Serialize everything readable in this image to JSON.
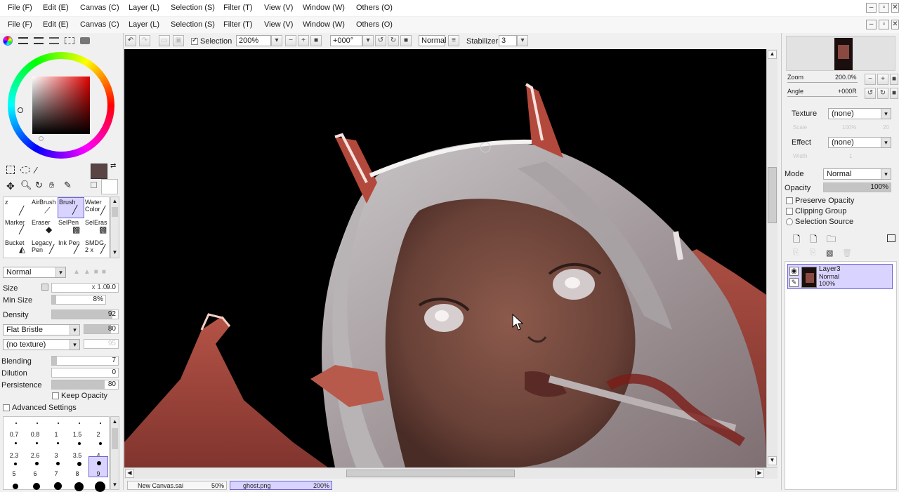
{
  "menu_outer": {
    "items": [
      "File (F)",
      "Edit (E)",
      "Canvas (C)",
      "Layer (L)",
      "Selection (S)",
      "Filter (T)",
      "View (V)",
      "Window (W)",
      "Others (O)"
    ]
  },
  "menu_inner": {
    "items": [
      "File (F)",
      "Edit (E)",
      "Canvas (C)",
      "Layer (L)",
      "Selection (S)",
      "Filter (T)",
      "View (V)",
      "Window (W)",
      "Others (O)"
    ]
  },
  "toolbar": {
    "selection_label": "Selection",
    "zoom_value": "200%",
    "rotation_value": "+000°",
    "blend_mode": "Normal",
    "stabilizer_label": "Stabilizer",
    "stabilizer_value": "3"
  },
  "colors": {
    "primary": "#5b4444",
    "secondary": "#ffffff",
    "accent_select": "#d9d4ff",
    "canvas_bg": "#000000"
  },
  "tools": [
    {
      "label": "z",
      "icon": "brush-icon"
    },
    {
      "label": "AirBrush",
      "icon": "airbrush-icon"
    },
    {
      "label": "Brush",
      "icon": "brush-icon",
      "selected": true
    },
    {
      "label": "Water Color",
      "icon": "watercolor-icon"
    },
    {
      "label": "Marker",
      "icon": "marker-icon"
    },
    {
      "label": "Eraser",
      "icon": "eraser-icon"
    },
    {
      "label": "SelPen",
      "icon": "selpen-icon"
    },
    {
      "label": "SelEras",
      "icon": "seleras-icon"
    },
    {
      "label": "Bucket",
      "icon": "bucket-icon"
    },
    {
      "label": "Legacy Pen",
      "icon": "pen-icon"
    },
    {
      "label": "Ink Pen",
      "icon": "inkpen-icon"
    },
    {
      "label": "SMDG 2 x",
      "icon": "brush-icon"
    }
  ],
  "brush": {
    "mode": "Normal",
    "size_label": "Size",
    "size_mult": "x 1.0",
    "size_value": "9.0",
    "minsize_label": "Min Size",
    "minsize_value": "8%",
    "density_label": "Density",
    "density_value": "92",
    "shape": "Flat Bristle",
    "shape_value": "80",
    "texture": "(no texture)",
    "texture_value": "95",
    "blending_label": "Blending",
    "blending_value": "7",
    "dilution_label": "Dilution",
    "dilution_value": "0",
    "persistence_label": "Persistence",
    "persistence_value": "80",
    "keep_opacity_label": "Keep Opacity",
    "advanced_label": "Advanced Settings"
  },
  "brush_sizes": {
    "row1": [
      "0.7",
      "0.8",
      "1",
      "1.5",
      "2"
    ],
    "row2": [
      "2.3",
      "2.6",
      "3",
      "3.5",
      "4"
    ],
    "row3": [
      "5",
      "6",
      "7",
      "8",
      "9"
    ]
  },
  "navigator": {
    "zoom_label": "Zoom",
    "zoom_value": "200.0%",
    "angle_label": "Angle",
    "angle_value": "+000R"
  },
  "layer_props": {
    "texture_label": "Texture",
    "texture_value": "(none)",
    "texture_scale": "Scale",
    "texture_scale_val": "100%",
    "texture_scale_num": "20",
    "effect_label": "Effect",
    "effect_value": "(none)",
    "effect_width": "Width",
    "effect_width_num": "1",
    "mode_label": "Mode",
    "mode_value": "Normal",
    "opacity_label": "Opacity",
    "opacity_value": "100%",
    "preserve_opacity": "Preserve Opacity",
    "clipping_group": "Clipping Group",
    "selection_source": "Selection Source"
  },
  "layer": {
    "name": "Layer3",
    "mode": "Normal",
    "opacity": "100%"
  },
  "tabs": [
    {
      "name": "New Canvas.sai",
      "zoom": "50%"
    },
    {
      "name": "ghost.png",
      "zoom": "200%"
    }
  ]
}
